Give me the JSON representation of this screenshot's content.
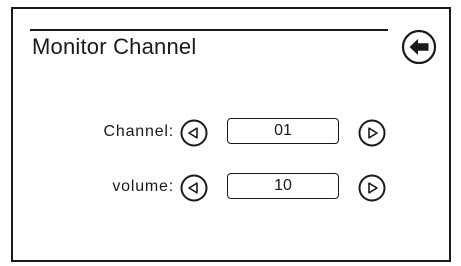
{
  "header": {
    "title": "Monitor Channel",
    "back_icon": "back-arrow-icon"
  },
  "settings": [
    {
      "label": "Channel:",
      "value": "01"
    },
    {
      "label": "volume:",
      "value": "10"
    }
  ],
  "icons": {
    "decrease": "triangle-left-icon",
    "increase": "triangle-right-icon"
  },
  "colors": {
    "foreground": "#1a1a1a",
    "background": "#ffffff"
  }
}
